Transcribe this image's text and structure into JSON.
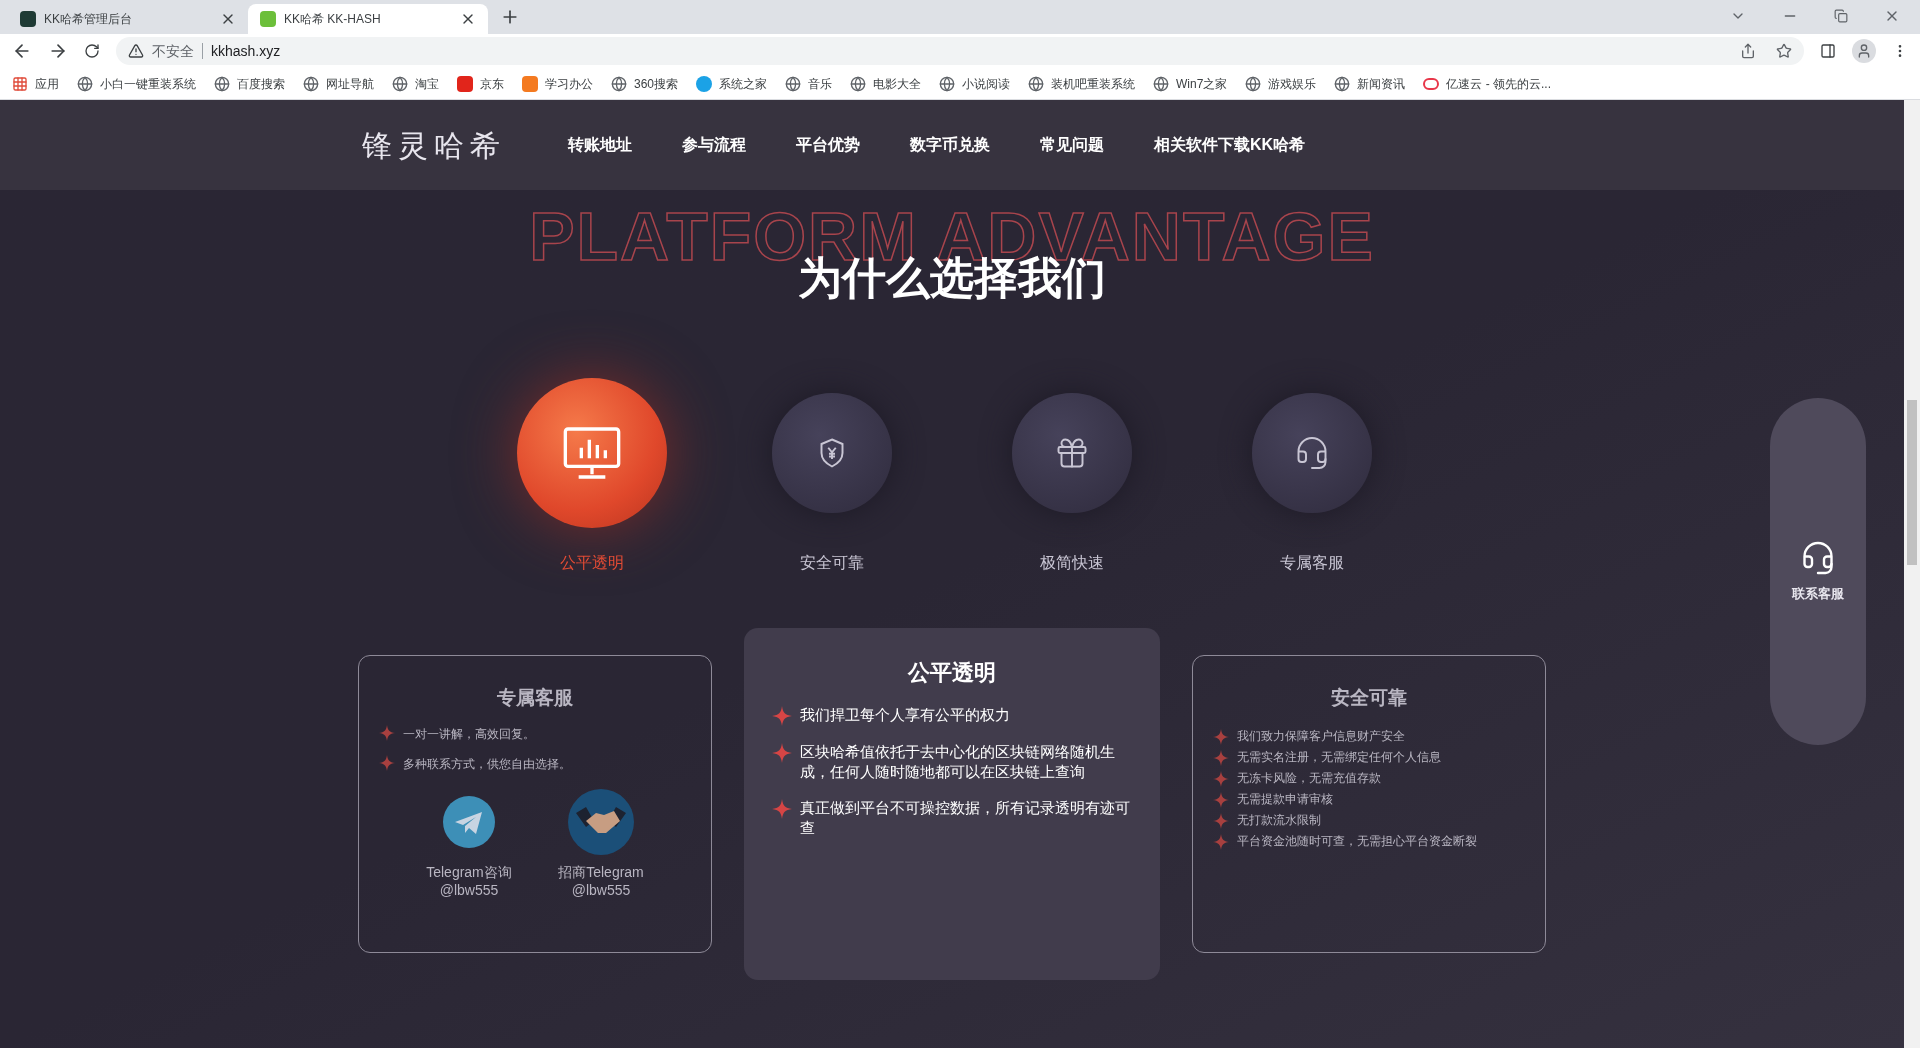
{
  "browser": {
    "tabs": [
      {
        "title": "KK哈希管理后台",
        "selected": false
      },
      {
        "title": "KK哈希 KK-HASH",
        "selected": true
      }
    ],
    "address": {
      "security_label": "不安全",
      "url": "kkhash.xyz"
    },
    "bookmarks": [
      {
        "label": "应用"
      },
      {
        "label": "小白一键重装系统"
      },
      {
        "label": "百度搜索"
      },
      {
        "label": "网址导航"
      },
      {
        "label": "淘宝"
      },
      {
        "label": "京东"
      },
      {
        "label": "学习办公"
      },
      {
        "label": "360搜索"
      },
      {
        "label": "系统之家"
      },
      {
        "label": "音乐"
      },
      {
        "label": "电影大全"
      },
      {
        "label": "小说阅读"
      },
      {
        "label": "装机吧重装系统"
      },
      {
        "label": "Win7之家"
      },
      {
        "label": "游戏娱乐"
      },
      {
        "label": "新闻资讯"
      },
      {
        "label": "亿速云 - 领先的云..."
      }
    ]
  },
  "site": {
    "logo": "锋灵哈希",
    "nav": [
      "转账地址",
      "参与流程",
      "平台优势",
      "数字币兑换",
      "常见问题",
      "相关软件下载KK哈希"
    ],
    "section": {
      "backdrop_title": "PLATFORM ADVANTAGE",
      "title": "为什么选择我们",
      "features": [
        {
          "label": "公平透明",
          "selected": true
        },
        {
          "label": "安全可靠",
          "selected": false
        },
        {
          "label": "极简快速",
          "selected": false
        },
        {
          "label": "专属客服",
          "selected": false
        }
      ],
      "cards": [
        {
          "kind": "contacts",
          "selected": false,
          "title": "专属客服",
          "items": [
            "一对一讲解，高效回复。",
            "多种联系方式，供您自由选择。"
          ],
          "contacts": [
            {
              "name": "Telegram咨询",
              "handle": "@lbw555"
            },
            {
              "name": "招商Telegram",
              "handle": "@lbw555"
            }
          ]
        },
        {
          "kind": "list",
          "selected": true,
          "title": "公平透明",
          "items": [
            "我们捍卫每个人享有公平的权力",
            "区块哈希值依托于去中心化的区块链网络随机生成，任何人随时随地都可以在区块链上查询",
            "真正做到平台不可操控数据，所有记录透明有迹可查"
          ]
        },
        {
          "kind": "list",
          "selected": false,
          "title": "安全可靠",
          "items": [
            "我们致力保障客户信息财产安全",
            "无需实名注册，无需绑定任何个人信息",
            "无冻卡风险，无需充值存款",
            "无需提款申请审核",
            "无打款流水限制",
            "平台资金池随时可查，无需担心平台资金断裂"
          ]
        }
      ]
    },
    "float_button": "联系客服"
  }
}
